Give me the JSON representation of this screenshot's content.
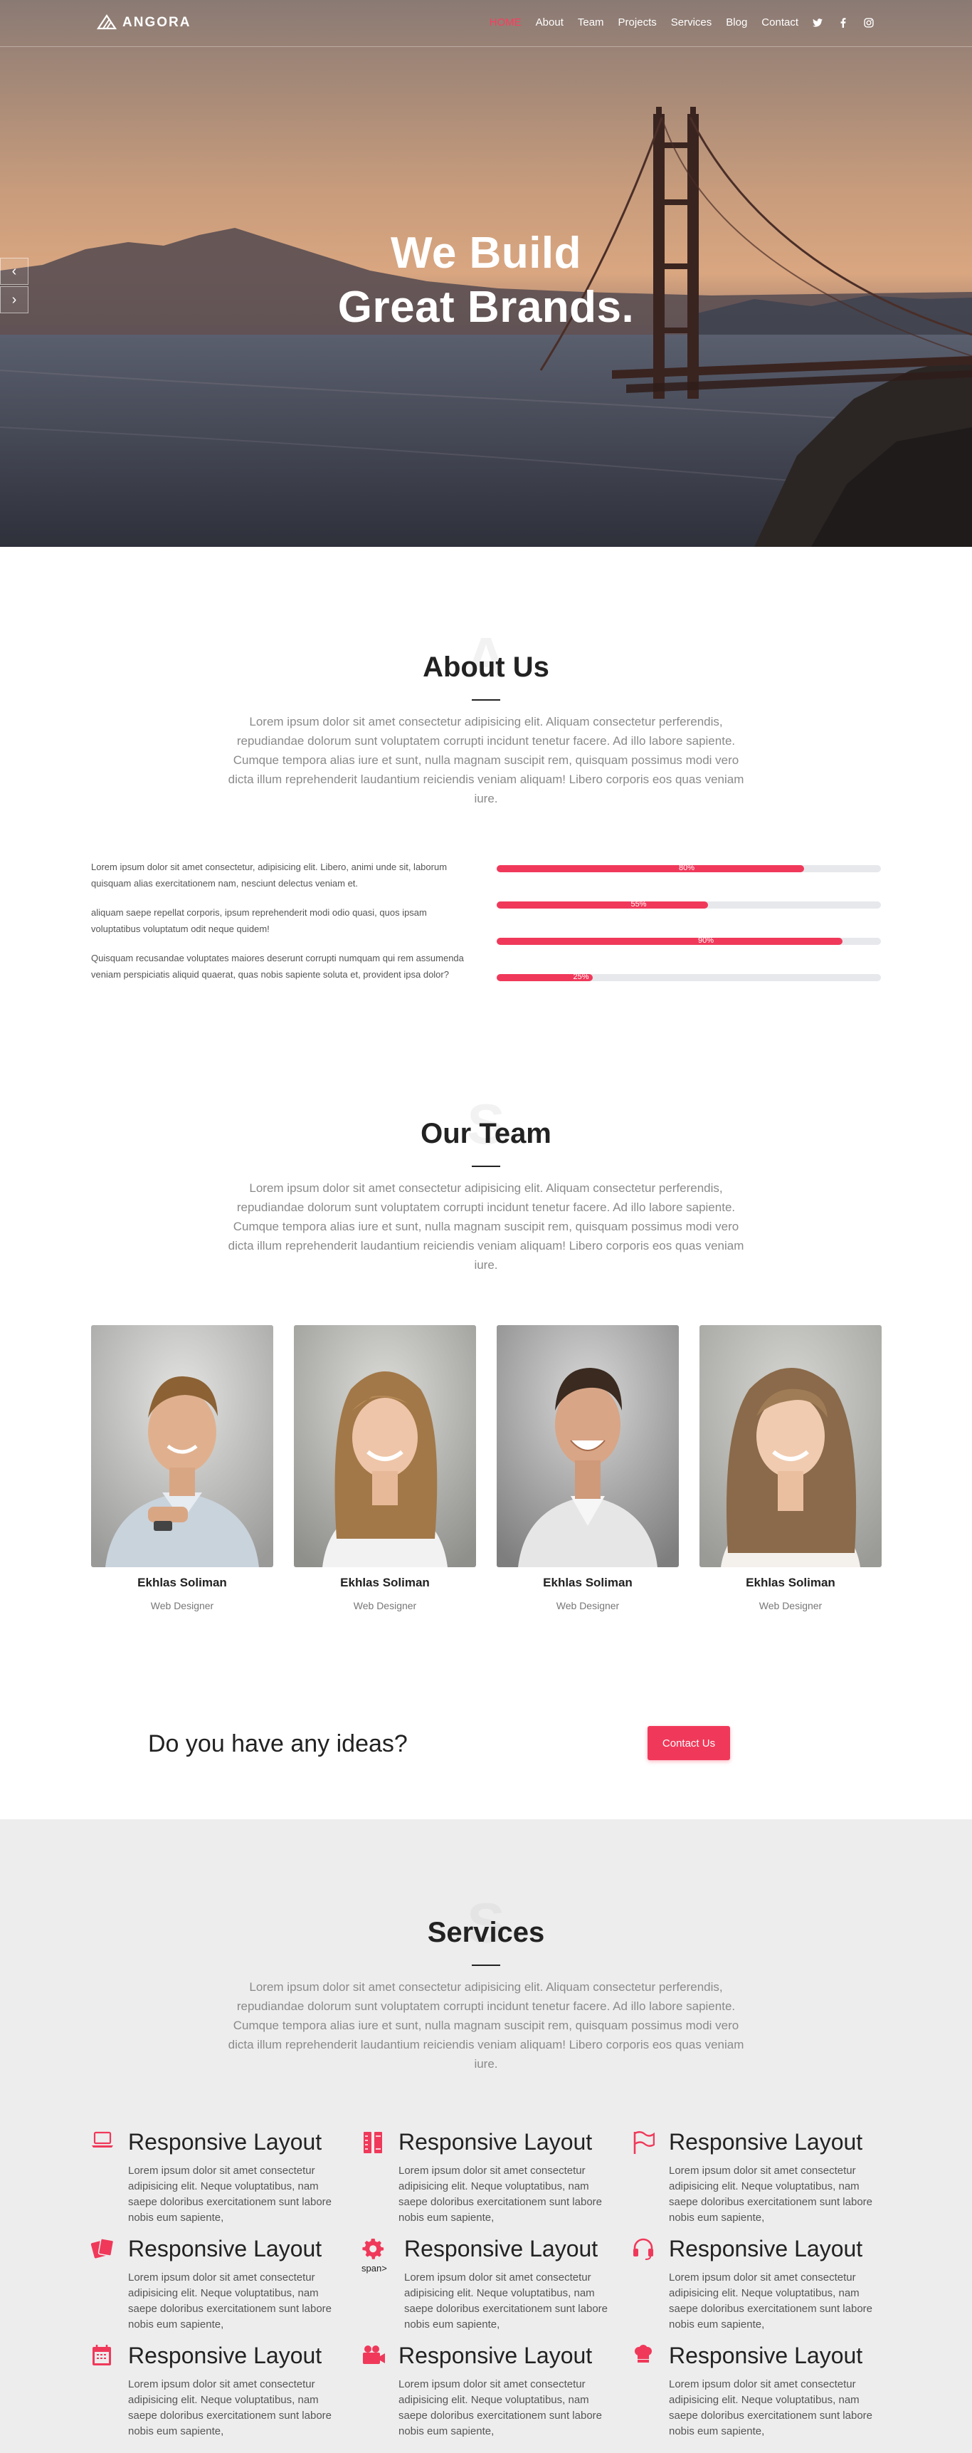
{
  "nav": {
    "brand": "ANGORA",
    "items": [
      {
        "label": "HOME",
        "active": true
      },
      {
        "label": "About"
      },
      {
        "label": "Team"
      },
      {
        "label": "Projects"
      },
      {
        "label": "Services"
      },
      {
        "label": "Blog"
      },
      {
        "label": "Contact"
      }
    ],
    "social": [
      "twitter-icon",
      "facebook-icon",
      "instagram-icon"
    ]
  },
  "hero": {
    "title_line1": "We Build",
    "title_line2": "Great Brands.",
    "prev_arrow": "‹",
    "next_arrow": "›"
  },
  "about": {
    "bg_letter": "A",
    "title": "About Us",
    "lead": "Lorem ipsum dolor sit amet consectetur adipisicing elit. Aliquam consectetur perferendis, repudiandae dolorum sunt voluptatem corrupti incidunt tenetur facere. Ad illo labore sapiente. Cumque tempora alias iure et sunt, nulla magnam suscipit rem, quisquam possimus modi vero dicta illum reprehenderit laudantium reiciendis veniam aliquam! Libero corporis eos quas veniam iure.",
    "paragraphs": [
      "Lorem ipsum dolor sit amet consectetur, adipisicing elit. Libero, animi unde sit, laborum quisquam alias exercitationem nam, nesciunt delectus veniam et.",
      "aliquam saepe repellat corporis, ipsum reprehenderit modi odio quasi, quos ipsam voluptatibus voluptatum odit neque quidem!",
      "Quisquam recusandae voluptates maiores deserunt corrupti numquam qui rem assumenda veniam perspiciatis aliquid quaerat, quas nobis sapiente soluta et, provident ipsa dolor?"
    ],
    "skills": [
      {
        "label": "80%",
        "value": 0.8
      },
      {
        "label": "55%",
        "value": 0.55
      },
      {
        "label": "90%",
        "value": 0.9
      },
      {
        "label": "25%",
        "value": 0.25
      }
    ]
  },
  "team": {
    "bg_letter": "S",
    "title": "Our Team",
    "lead": "Lorem ipsum dolor sit amet consectetur adipisicing elit. Aliquam consectetur perferendis, repudiandae dolorum sunt voluptatem corrupti incidunt tenetur facere. Ad illo labore sapiente. Cumque tempora alias iure et sunt, nulla magnam suscipit rem, quisquam possimus modi vero dicta illum reprehenderit laudantium reiciendis veniam aliquam! Libero corporis eos quas veniam iure.",
    "members": [
      {
        "name": "Ekhlas Soliman",
        "role": "Web Designer"
      },
      {
        "name": "Ekhlas Soliman",
        "role": "Web Designer"
      },
      {
        "name": "Ekhlas Soliman",
        "role": "Web Designer"
      },
      {
        "name": "Ekhlas Soliman",
        "role": "Web Designer"
      }
    ]
  },
  "cta": {
    "text": "Do you have any ideas?",
    "button": "Contact Us"
  },
  "services": {
    "bg_letter": "S",
    "title": "Services",
    "lead": "Lorem ipsum dolor sit amet consectetur adipisicing elit. Aliquam consectetur perferendis, repudiandae dolorum sunt voluptatem corrupti incidunt tenetur facere. Ad illo labore sapiente. Cumque tempora alias iure et sunt, nulla magnam suscipit rem, quisquam possimus modi vero dicta illum reprehenderit laudantium reiciendis veniam aliquam! Libero corporis eos quas veniam iure.",
    "items": [
      {
        "icon": "laptop-icon",
        "title": "Responsive Layout",
        "desc": "Lorem ipsum dolor sit amet consectetur adipisicing elit. Neque voluptatibus, nam saepe doloribus exercitationem sunt labore nobis eum sapiente,"
      },
      {
        "icon": "pencil-ruler-icon",
        "title": "Responsive Layout",
        "desc": "Lorem ipsum dolor sit amet consectetur adipisicing elit. Neque voluptatibus, nam saepe doloribus exercitationem sunt labore nobis eum sapiente,"
      },
      {
        "icon": "flag-icon",
        "title": "Responsive Layout",
        "desc": "Lorem ipsum dolor sit amet consectetur adipisicing elit. Neque voluptatibus, nam saepe doloribus exercitationem sunt labore nobis eum sapiente,"
      },
      {
        "icon": "cards-icon",
        "title": "Responsive Layout",
        "desc": "Lorem ipsum dolor sit amet consectetur adipisicing elit. Neque voluptatibus, nam saepe doloribus exercitationem sunt labore nobis eum sapiente,"
      },
      {
        "icon": "gear-icon",
        "title": "Responsive Layout",
        "desc": "Lorem ipsum dolor sit amet consectetur adipisicing elit. Neque voluptatibus, nam saepe doloribus exercitationem sunt labore nobis eum sapiente,",
        "extra_label": "span>"
      },
      {
        "icon": "headset-icon",
        "title": "Responsive Layout",
        "desc": "Lorem ipsum dolor sit amet consectetur adipisicing elit. Neque voluptatibus, nam saepe doloribus exercitationem sunt labore nobis eum sapiente,"
      },
      {
        "icon": "calendar-icon",
        "title": "Responsive Layout",
        "desc": "Lorem ipsum dolor sit amet consectetur adipisicing elit. Neque voluptatibus, nam saepe doloribus exercitationem sunt labore nobis eum sapiente,"
      },
      {
        "icon": "video-camera-icon",
        "title": "Responsive Layout",
        "desc": "Lorem ipsum dolor sit amet consectetur adipisicing elit. Neque voluptatibus, nam saepe doloribus exercitationem sunt labore nobis eum sapiente,"
      },
      {
        "icon": "chef-icon",
        "title": "Responsive Layout",
        "desc": "Lorem ipsum dolor sit amet consectetur adipisicing elit. Neque voluptatibus, nam saepe doloribus exercitationem sunt labore nobis eum sapiente,"
      }
    ]
  },
  "colors": {
    "accent": "#f0395a",
    "nav_active": "#fc3c5c",
    "services_bg": "#ededed"
  }
}
